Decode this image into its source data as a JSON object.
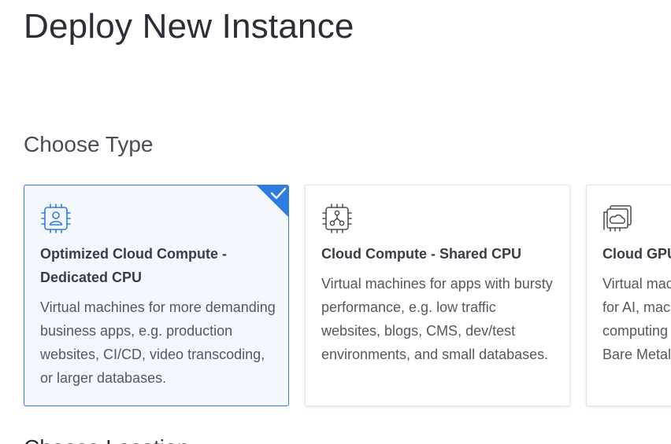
{
  "page": {
    "title": "Deploy New Instance"
  },
  "choose_type": {
    "heading": "Choose Type",
    "cards": [
      {
        "title": "Optimized Cloud Compute - Dedicated CPU",
        "description": "Virtual machines for more demanding business apps, e.g. production websites, CI/CD, video transcoding, or larger databases.",
        "icon": "cpu-user-icon",
        "selected": true
      },
      {
        "title": "Cloud Compute - Shared CPU",
        "description": "Virtual machines for apps with bursty performance, e.g. low traffic websites, blogs, CMS, dev/test environments, and small databases.",
        "icon": "cpu-network-icon",
        "selected": false
      },
      {
        "title": "Cloud GPU",
        "description": "Virtual machines with full NVIDIA GPUs for AI, machine learning, HPC, visual computing and VDI. Also available as Bare Metal.",
        "icon": "gpu-cloud-icon",
        "selected": false
      }
    ]
  },
  "next_section": {
    "heading": "Choose Location"
  },
  "colors": {
    "accent": "#2f7de1",
    "selected_bg": "#f4f8fe",
    "text": "#3a3d45"
  }
}
